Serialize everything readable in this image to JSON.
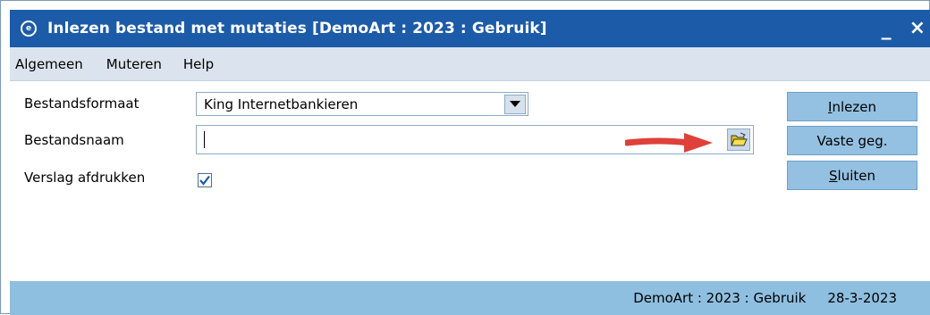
{
  "window": {
    "title": "Inlezen bestand met mutaties  [DemoArt : 2023 : Gebruik]",
    "minimize_label": "_",
    "close_label": "×"
  },
  "menu": {
    "items": [
      {
        "label": "Algemeen"
      },
      {
        "label": "Muteren"
      },
      {
        "label": "Help"
      }
    ]
  },
  "form": {
    "format_label": "Bestandsformaat",
    "format_value": "King Internetbankieren",
    "filename_label": "Bestandsnaam",
    "filename_value": "",
    "report_label": "Verslag afdrukken",
    "report_checked": true
  },
  "buttons": {
    "read": "Inlezen",
    "read_mnemonic": "I",
    "fixed": "Vaste geg.",
    "close": "Sluiten",
    "close_mnemonic": "S"
  },
  "status": {
    "context": "DemoArt : 2023 : Gebruik",
    "date": "28-3-2023"
  },
  "colors": {
    "titlebar": "#1c5ba8",
    "menubar": "#dbe4ee",
    "button": "#94c1e2",
    "statusbar": "#8fbfe0",
    "annotation_arrow": "#e0403a",
    "folder_icon": "#f2d21f"
  },
  "icons": {
    "title": "app-icon",
    "dropdown": "chevron-down-icon",
    "browse": "folder-open-icon",
    "checkbox": "checkmark-icon"
  }
}
